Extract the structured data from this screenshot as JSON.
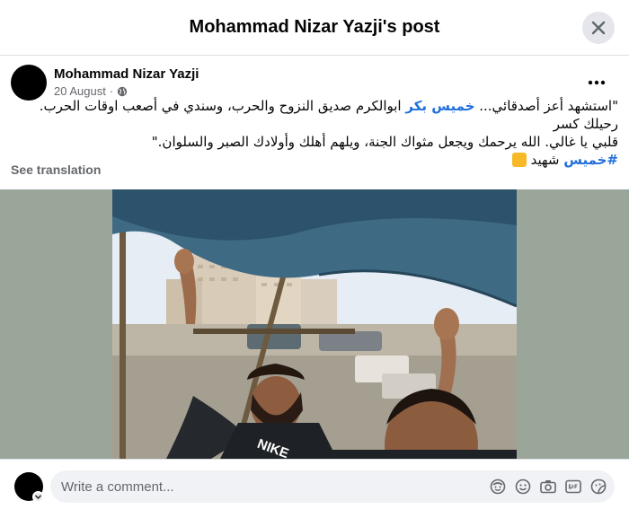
{
  "header": {
    "title": "Mohammad Nizar Yazji's post"
  },
  "post": {
    "author": "Mohammad Nizar Yazji",
    "date": "20 August",
    "privacy_icon": "globe-icon",
    "text_line1_start": "\"استشهد أعز أصدقائي... ",
    "mention": "خميس بكر",
    "text_line1_end": " ابوالكرم صديق النزوح والحرب، وسندي في أصعب اوقات الحرب. رحيلك كسر",
    "text_line2": "قلبي يا غالي. الله يرحمك ويجعل مثواك الجنة، ويلهم أهلك وأولادك الصبر والسلوان.\"",
    "hashtag": "#خميس",
    "hashtag_after": " شهيد",
    "see_translation": "See translation",
    "photo_shirt_text": "NIKE"
  },
  "comment": {
    "placeholder": "Write a comment..."
  },
  "icons": {
    "close": "close-icon",
    "more": "more-options-icon",
    "avatar_sticker": "avatar-sticker-icon",
    "emoji": "emoji-icon",
    "camera": "camera-icon",
    "gif": "gif-icon",
    "sticker": "sticker-icon"
  },
  "colors": {
    "link": "#216fdb",
    "secondary": "#65676b",
    "input_bg": "#f0f2f5"
  }
}
